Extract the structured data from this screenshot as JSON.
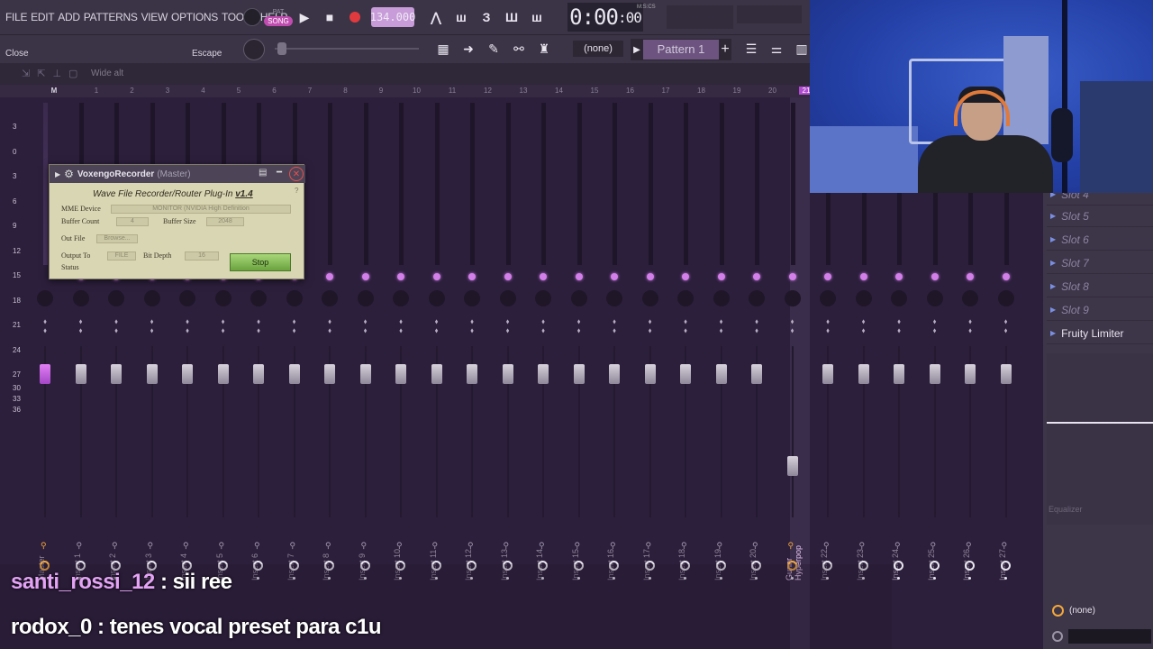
{
  "menu": {
    "items": [
      "FILE",
      "EDIT",
      "ADD",
      "PATTERNS",
      "VIEW",
      "OPTIONS",
      "TOOLS",
      "HELP"
    ],
    "pat_label": "PAT",
    "song_label": "SONG",
    "bpm": "134.000",
    "time": "0:00",
    "time_sub": ":00",
    "time_mode": "M:S:CS"
  },
  "toolbar2": {
    "close_label": "Close",
    "escape_label": "Escape",
    "none_label": "(none)",
    "pattern_label": "Pattern 1",
    "wide_alt": "Wide alt"
  },
  "mixer": {
    "header_m": "M",
    "header_numbers": [
      "1",
      "2",
      "3",
      "4",
      "5",
      "6",
      "7",
      "8",
      "9",
      "10",
      "11",
      "12",
      "13",
      "14",
      "15",
      "16",
      "17",
      "18",
      "19",
      "20",
      "21"
    ],
    "db_scale": [
      "3",
      "0",
      "3",
      "6",
      "9",
      "12",
      "15",
      "18",
      "21",
      "24",
      "27",
      "30",
      "33",
      "36"
    ],
    "tracks": [
      "Master",
      "Insert 1",
      "Insert 2",
      "Insert 3",
      "Insert 4",
      "Insert 5",
      "Insert 6",
      "Insert 7",
      "Insert 8",
      "Insert 9",
      "Insert 10",
      "Insert 11",
      "Insert 12",
      "Insert 13",
      "Insert 14",
      "Insert 15",
      "Insert 16",
      "Insert 17",
      "Insert 18",
      "Insert 19",
      "Insert 20",
      "Gunnr Hyperpop",
      "Insert 22",
      "Insert 23",
      "Insert 24",
      "Insert 25",
      "Insert 26",
      "Insert 27"
    ]
  },
  "right_panel": {
    "slots": [
      "Slot 4",
      "Slot 5",
      "Slot 6",
      "Slot 7",
      "Slot 8",
      "Slot 9"
    ],
    "active_plugin": "Fruity Limiter",
    "eq_label": "Equalizer",
    "output": "(none)"
  },
  "plugin": {
    "name": "VoxengoRecorder",
    "context": "(Master)",
    "heading": "Wave File Recorder/Router Plug-In",
    "version": "v1.4",
    "mme_label": "MME Device",
    "mme_value": "MONITOR (NVIDIA High Definition",
    "buffer_count_label": "Buffer Count",
    "buffer_count_value": "4",
    "buffer_size_label": "Buffer Size",
    "buffer_size_value": "2048",
    "out_file_label": "Out File",
    "browse_label": "Browse...",
    "output_to_label": "Output To",
    "output_to_value": "FILE",
    "bit_depth_label": "Bit Depth",
    "bit_depth_value": "16",
    "status_label": "Status",
    "stop_label": "Stop",
    "help_label": "?"
  },
  "chat": [
    {
      "user": "santi_rossi_12",
      "message": "sii ree"
    },
    {
      "user": "rodox_0",
      "message": "tenes vocal preset para c1u"
    }
  ],
  "colors": {
    "accent": "#c04caf",
    "route_dot": "#d27fe9",
    "record": "#e03a3e",
    "stop_green": "#8cc55b"
  }
}
